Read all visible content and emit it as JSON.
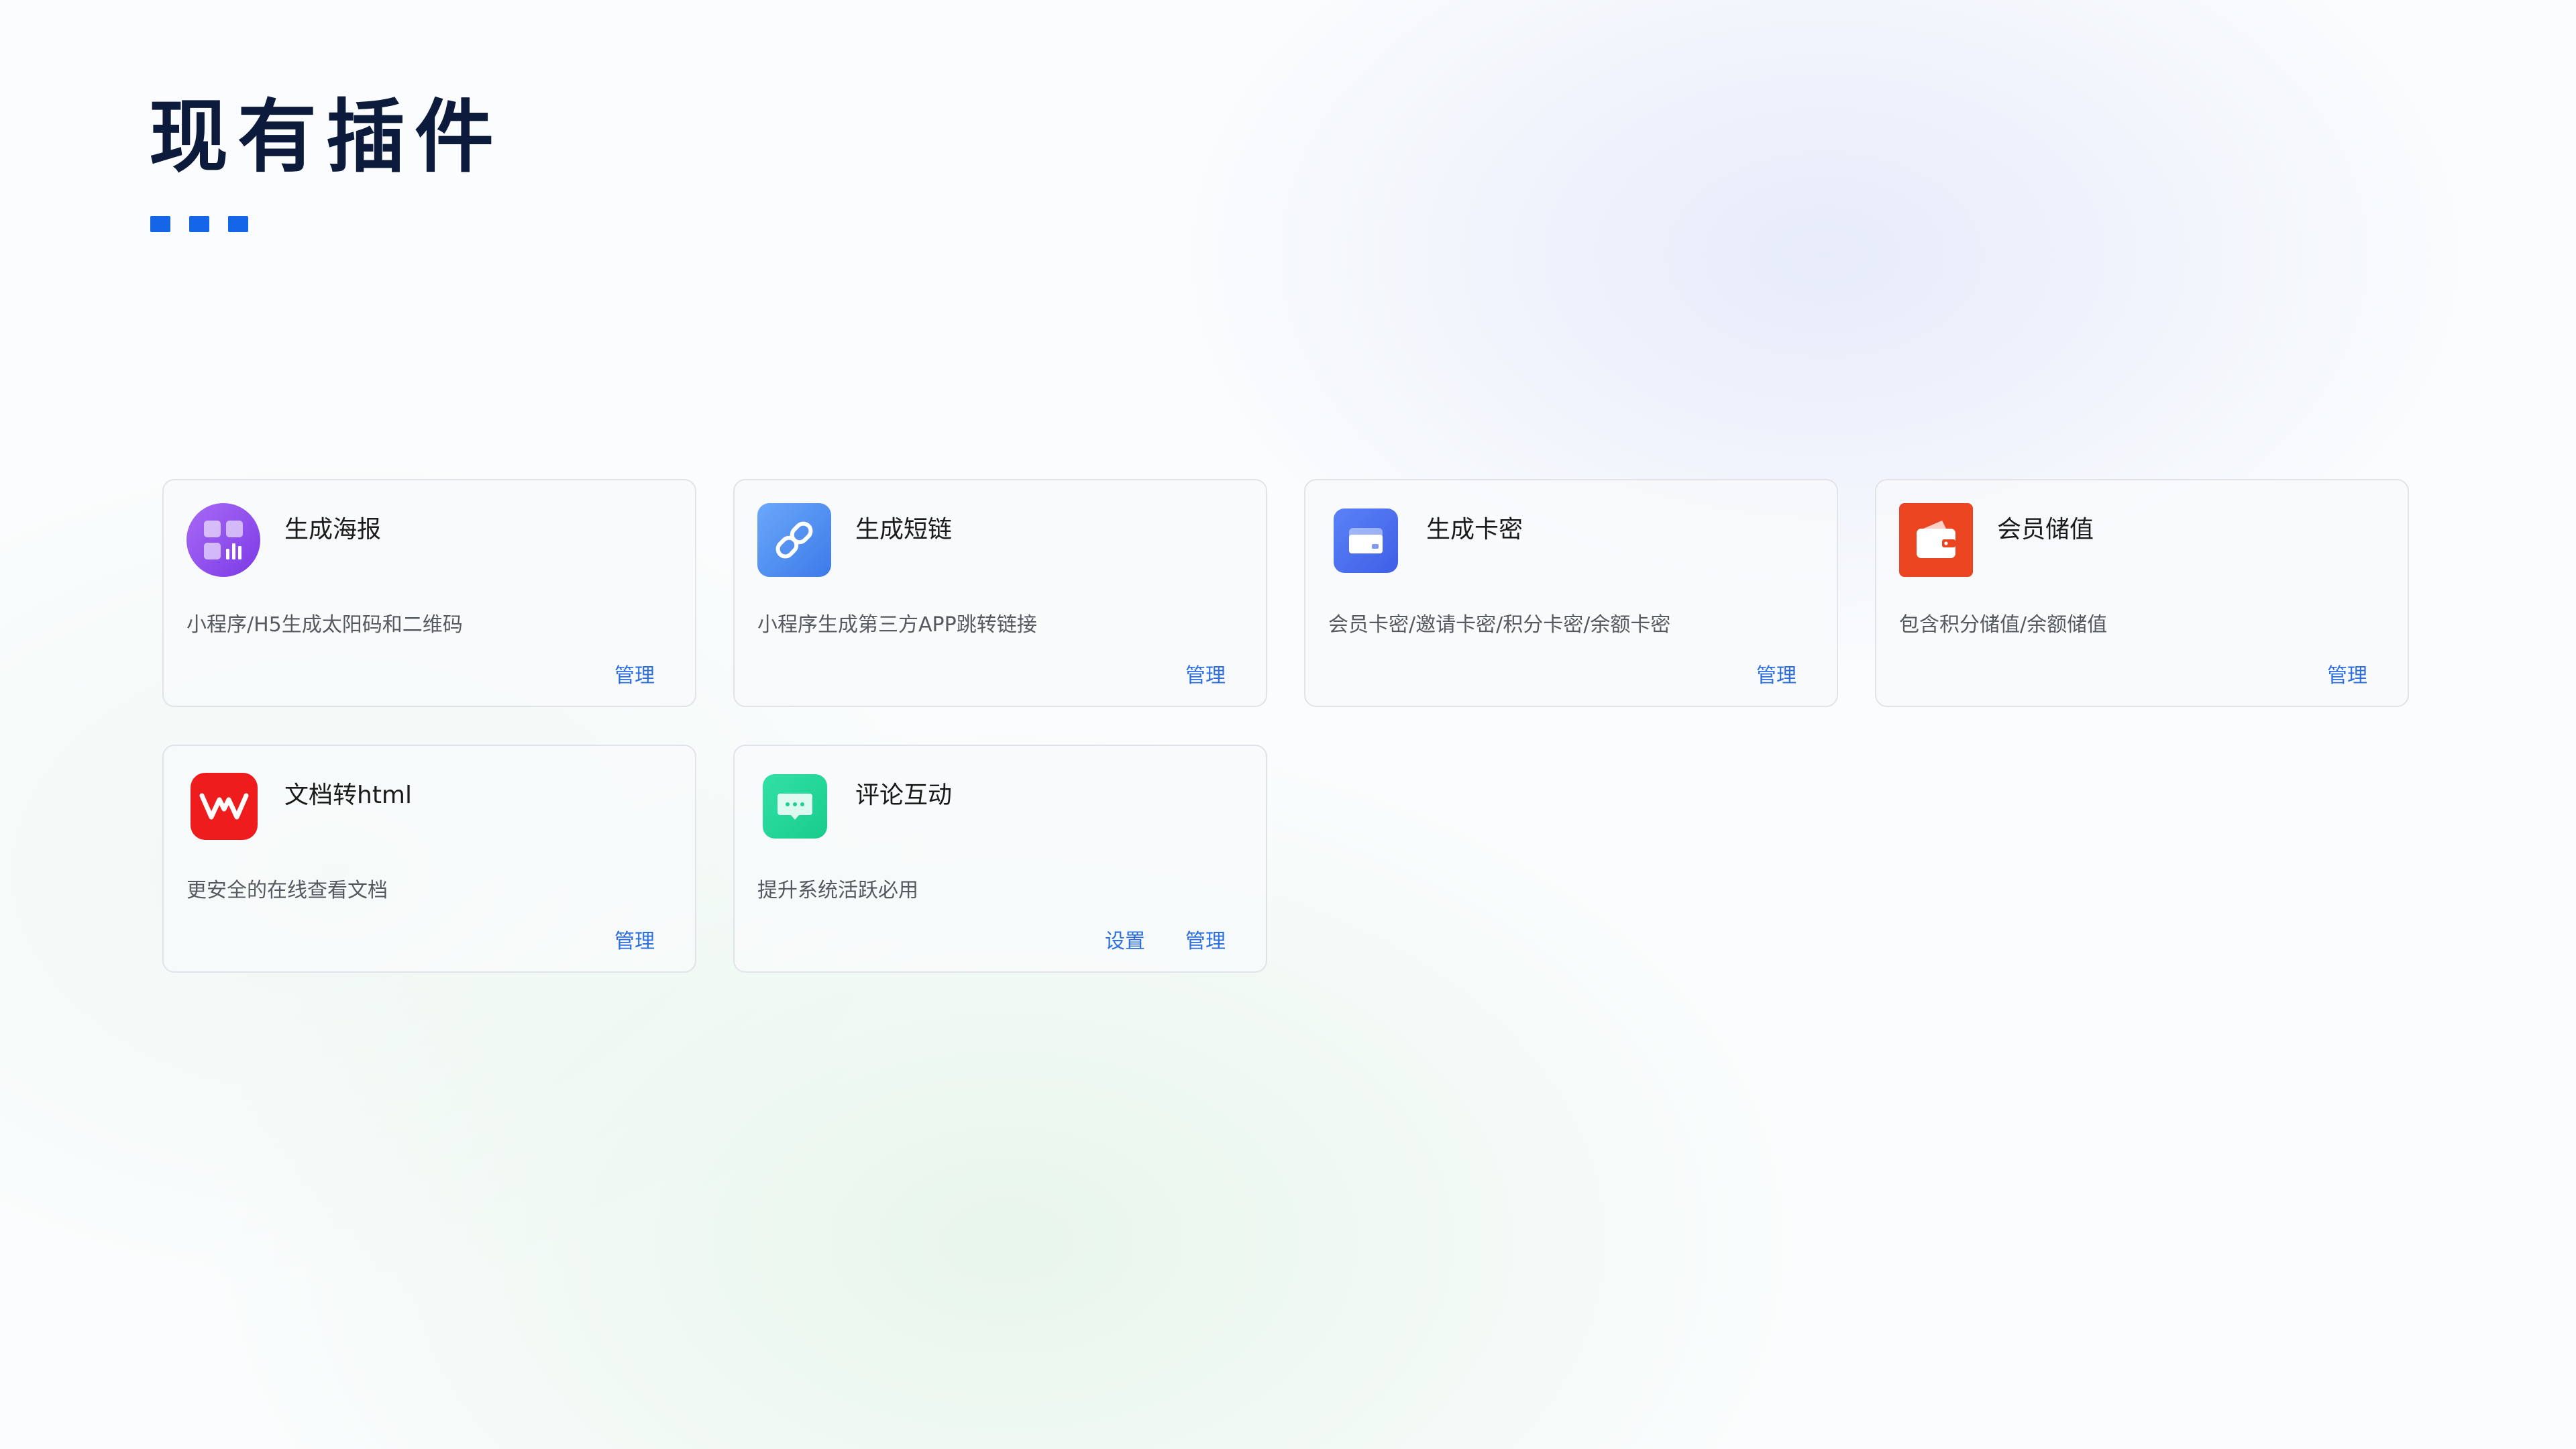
{
  "page": {
    "title": "现有插件"
  },
  "colors": {
    "accent": "#1565e8",
    "link": "#2e6fe0",
    "title": "#0c1a3c"
  },
  "plugins": [
    {
      "title": "生成海报",
      "description": "小程序/H5生成太阳码和二维码",
      "icon": "grid-chart-icon",
      "actions": [
        "管理"
      ]
    },
    {
      "title": "生成短链",
      "description": "小程序生成第三方APP跳转链接",
      "icon": "link-icon",
      "actions": [
        "管理"
      ]
    },
    {
      "title": "生成卡密",
      "description": "会员卡密/邀请卡密/积分卡密/余额卡密",
      "icon": "card-icon",
      "actions": [
        "管理"
      ]
    },
    {
      "title": "会员储值",
      "description": "包含积分储值/余额储值",
      "icon": "wallet-icon",
      "actions": [
        "管理"
      ]
    },
    {
      "title": "文档转html",
      "description": "更安全的在线查看文档",
      "icon": "wps-icon",
      "actions": [
        "管理"
      ]
    },
    {
      "title": "评论互动",
      "description": "提升系统活跃必用",
      "icon": "comment-icon",
      "actions": [
        "设置",
        "管理"
      ]
    }
  ]
}
